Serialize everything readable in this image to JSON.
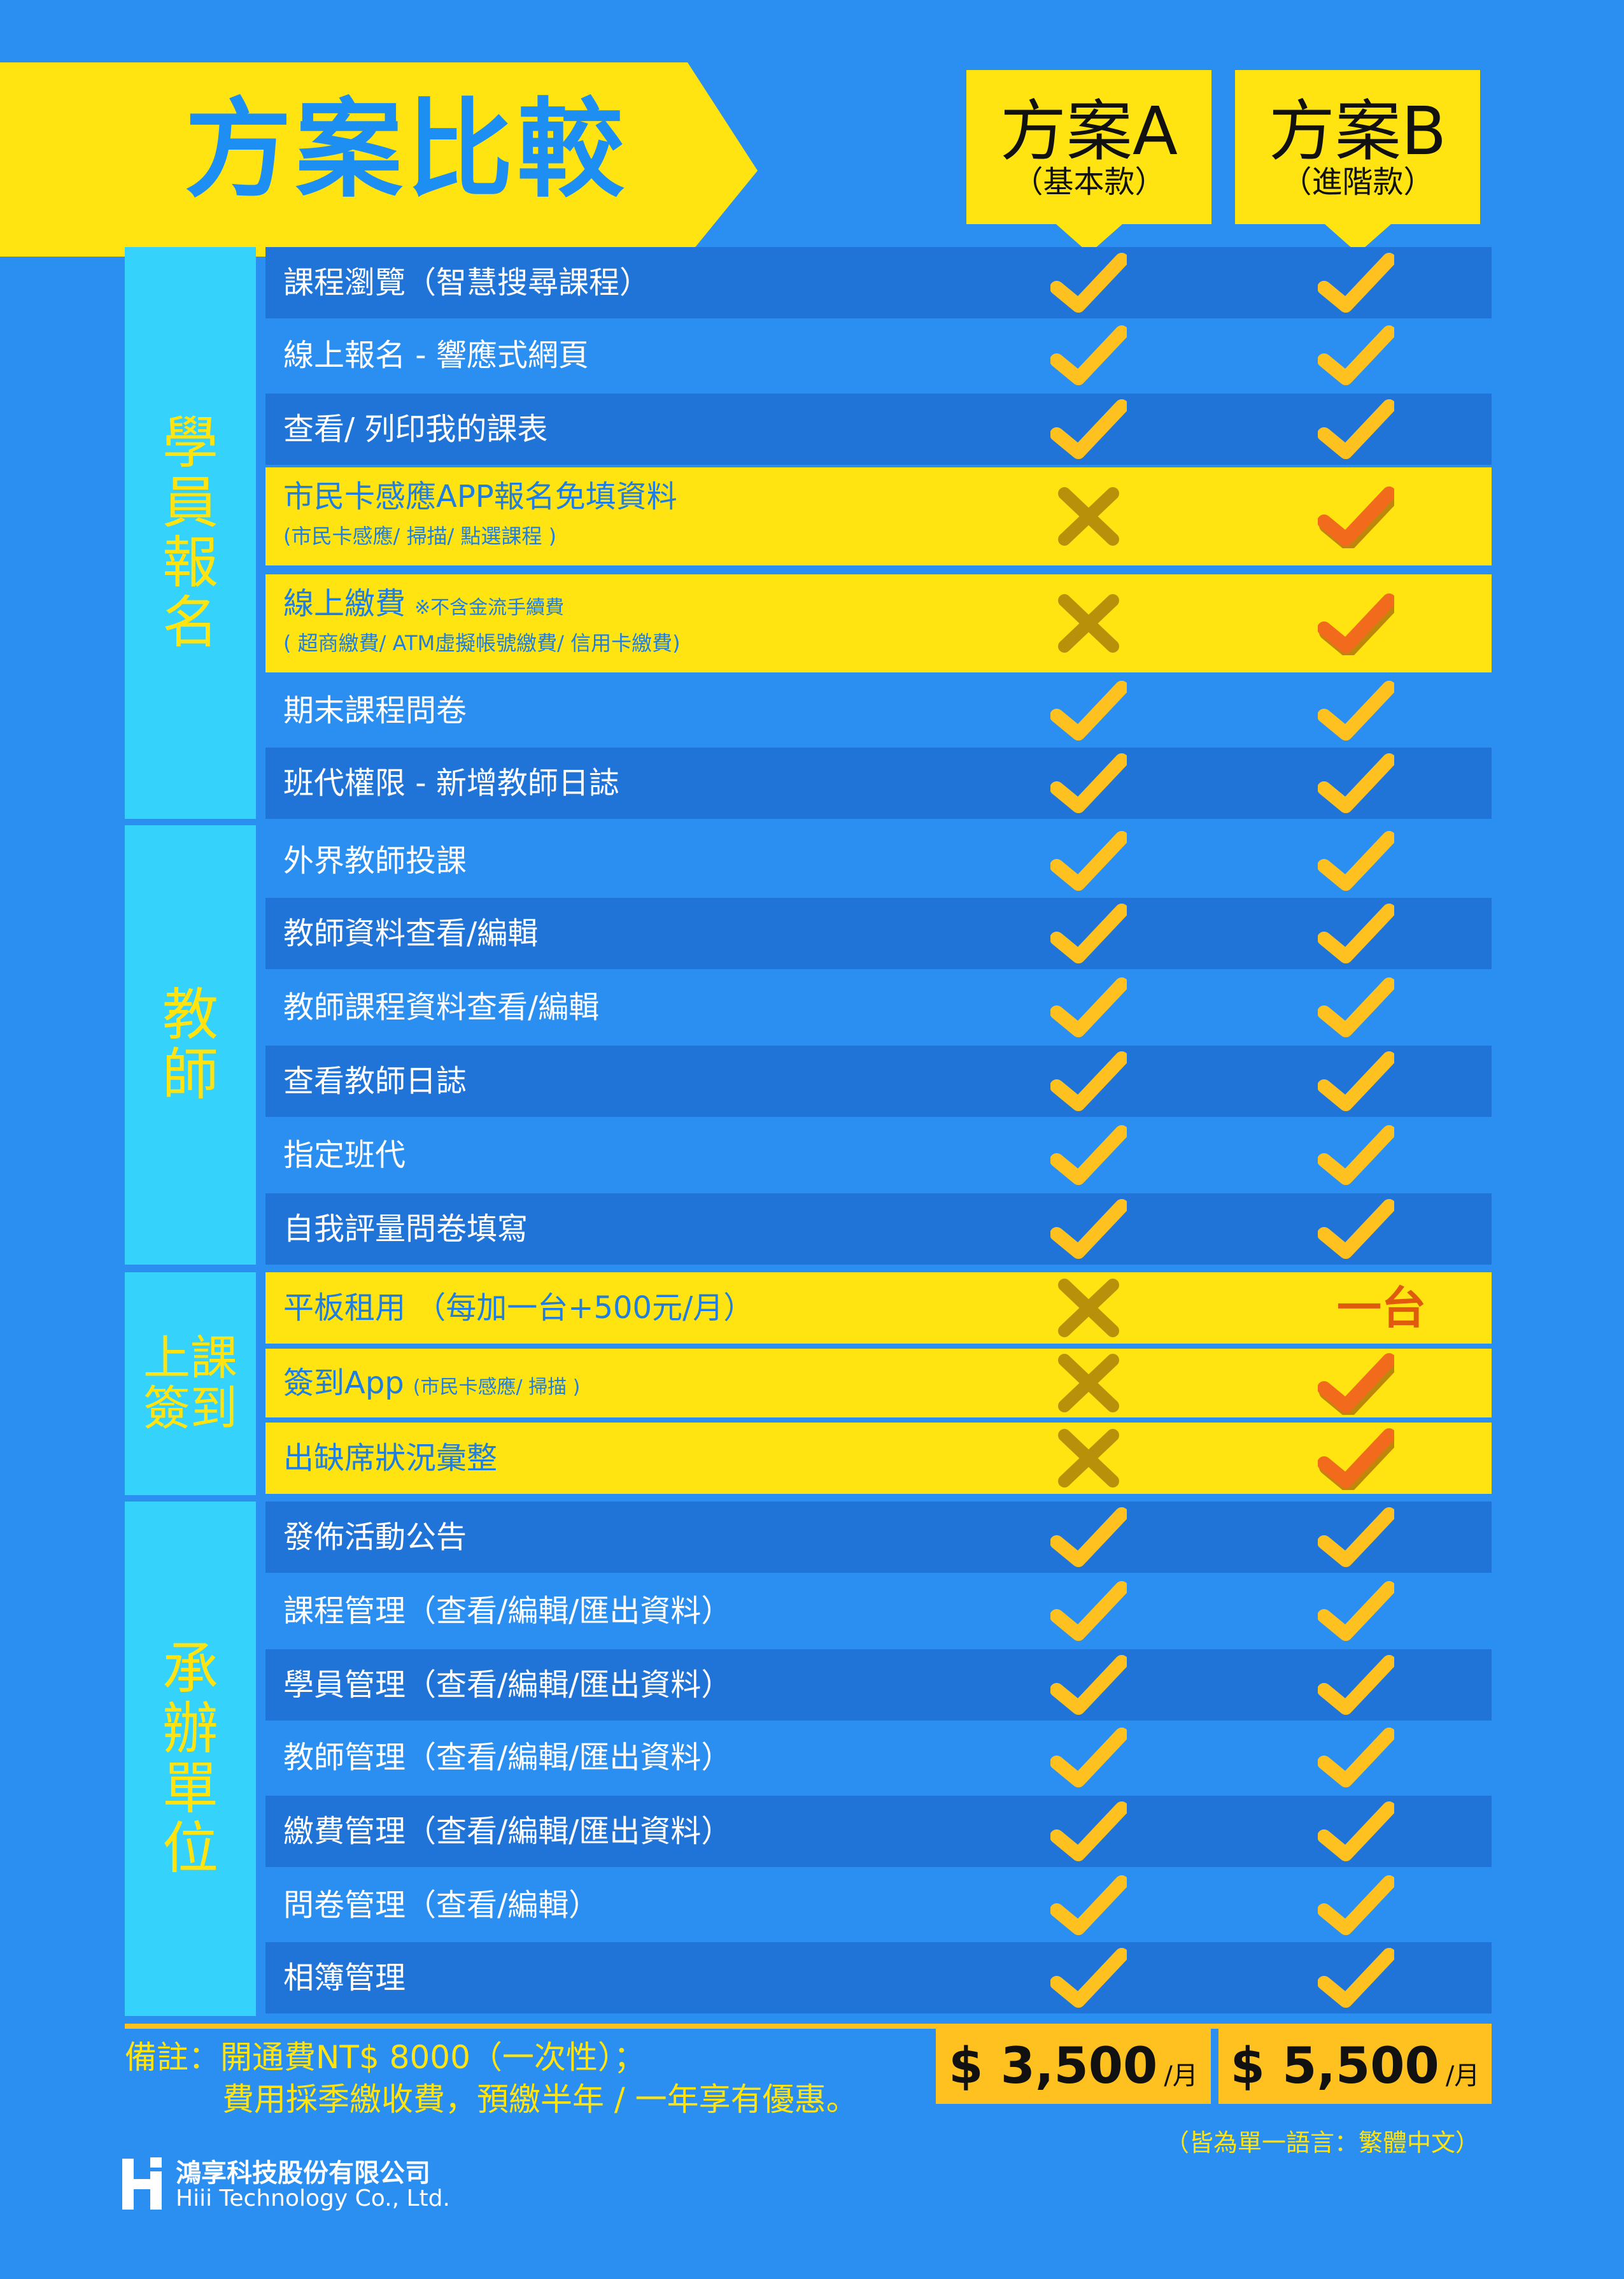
{
  "title": "方案比較",
  "plans": [
    {
      "name": "方案A",
      "subtitle": "（基本款）"
    },
    {
      "name": "方案B",
      "subtitle": "（進階款）"
    }
  ],
  "categories": [
    {
      "label": "學員報名"
    },
    {
      "label": "教師"
    },
    {
      "label": "上課簽到"
    },
    {
      "label": "承辦單位"
    }
  ],
  "rows": [
    {
      "label": "課程瀏覽（智慧搜尋課程）",
      "a": "check",
      "b": "check"
    },
    {
      "label": "線上報名 - 響應式網頁",
      "a": "check",
      "b": "check"
    },
    {
      "label": "查看/ 列印我的課表",
      "a": "check",
      "b": "check"
    },
    {
      "label": "市民卡感應APP報名免填資料",
      "sub": "(市民卡感應/ 掃描/ 點選課程 )",
      "a": "cross",
      "b": "check"
    },
    {
      "label": "線上繳費",
      "note": "※不含金流手續費",
      "sub": "( 超商繳費/ ATM虛擬帳號繳費/ 信用卡繳費)",
      "a": "cross",
      "b": "check"
    },
    {
      "label": "期末課程問卷",
      "a": "check",
      "b": "check"
    },
    {
      "label": "班代權限 - 新增教師日誌",
      "a": "check",
      "b": "check"
    },
    {
      "label": "外界教師投課",
      "a": "check",
      "b": "check"
    },
    {
      "label": "教師資料查看/編輯",
      "a": "check",
      "b": "check"
    },
    {
      "label": "教師課程資料查看/編輯",
      "a": "check",
      "b": "check"
    },
    {
      "label": "查看教師日誌",
      "a": "check",
      "b": "check"
    },
    {
      "label": "指定班代",
      "a": "check",
      "b": "check"
    },
    {
      "label": "自我評量問卷填寫",
      "a": "check",
      "b": "check"
    },
    {
      "label": "平板租用 （每加一台+500元/月）",
      "a": "cross",
      "b": "text",
      "b_text": "一台"
    },
    {
      "label": "簽到App",
      "note": "(市民卡感應/ 掃描 )",
      "a": "cross",
      "b": "check"
    },
    {
      "label": "出缺席狀況彙整",
      "a": "cross",
      "b": "check"
    },
    {
      "label": "發佈活動公告",
      "a": "check",
      "b": "check"
    },
    {
      "label": "課程管理（查看/編輯/匯出資料）",
      "a": "check",
      "b": "check"
    },
    {
      "label": "學員管理（查看/編輯/匯出資料）",
      "a": "check",
      "b": "check"
    },
    {
      "label": "教師管理（查看/編輯/匯出資料）",
      "a": "check",
      "b": "check"
    },
    {
      "label": "繳費管理（查看/編輯/匯出資料）",
      "a": "check",
      "b": "check"
    },
    {
      "label": "問卷管理（查看/編輯）",
      "a": "check",
      "b": "check"
    },
    {
      "label": "相簿管理",
      "a": "check",
      "b": "check"
    }
  ],
  "prices": [
    {
      "amount": "$ 3,500",
      "unit": "/月"
    },
    {
      "amount": "$ 5,500",
      "unit": "/月"
    }
  ],
  "remark": {
    "line1": "備註：開通費NT$ 8000（一次性）；",
    "line2": "費用採季繳收費，預繳半年 / 一年享有優惠。"
  },
  "language_note": "（皆為單一語言：繁體中文）",
  "company": {
    "name_zh": "鴻享科技股份有限公司",
    "name_en": "Hiii Technology Co., Ltd."
  },
  "colors": {
    "background": "#2a8ff0",
    "yellow": "#ffe411",
    "cyan": "#35d3fb",
    "check": "#ffc11f",
    "check_highlight": "#f26a1b",
    "cross": "#b8900a"
  }
}
